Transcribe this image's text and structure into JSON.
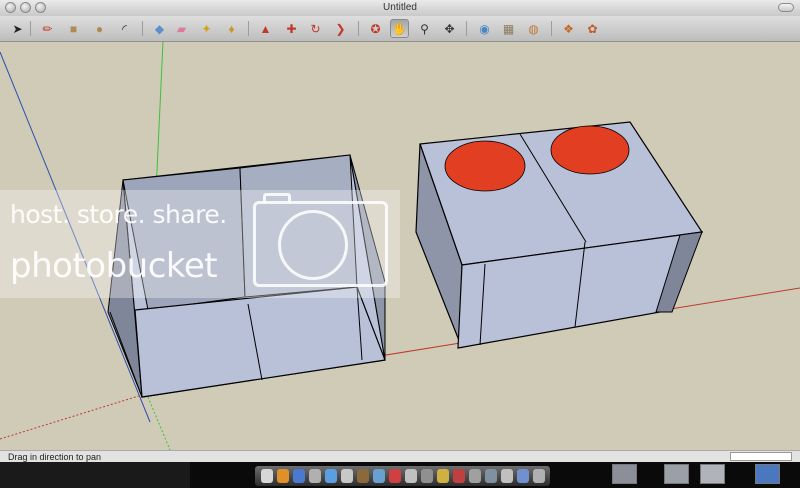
{
  "window": {
    "title": "Untitled"
  },
  "toolbar": {
    "tools": [
      {
        "icon": "select-arrow-icon",
        "glyph": "➤",
        "color": "#222"
      },
      {
        "icon": "pencil-icon",
        "glyph": "✏",
        "color": "#c0392b"
      },
      {
        "icon": "rectangle-icon",
        "glyph": "■",
        "color": "#b08a55"
      },
      {
        "icon": "circle-icon",
        "glyph": "●",
        "color": "#b08a55"
      },
      {
        "icon": "arc-icon",
        "glyph": "◜",
        "color": "#222"
      },
      {
        "icon": "make-component-icon",
        "glyph": "◆",
        "color": "#5e8fc9"
      },
      {
        "icon": "eraser-icon",
        "glyph": "▰",
        "color": "#e07a9a"
      },
      {
        "icon": "tape-measure-icon",
        "glyph": "✦",
        "color": "#d4a017"
      },
      {
        "icon": "paint-bucket-icon",
        "glyph": "♦",
        "color": "#c89a2c"
      },
      {
        "icon": "push-pull-icon",
        "glyph": "▲",
        "color": "#c0392b"
      },
      {
        "icon": "move-icon",
        "glyph": "✚",
        "color": "#c0392b"
      },
      {
        "icon": "rotate-icon",
        "glyph": "↻",
        "color": "#c0392b"
      },
      {
        "icon": "offset-icon",
        "glyph": "❯",
        "color": "#c0392b"
      },
      {
        "icon": "orbit-icon",
        "glyph": "✪",
        "color": "#c0392b"
      },
      {
        "icon": "pan-hand-icon",
        "glyph": "✋",
        "color": "#333"
      },
      {
        "icon": "zoom-icon",
        "glyph": "⚲",
        "color": "#333"
      },
      {
        "icon": "zoom-extents-icon",
        "glyph": "✥",
        "color": "#333"
      },
      {
        "icon": "get-models-icon",
        "glyph": "◉",
        "color": "#4a86c5"
      },
      {
        "icon": "share-model-icon",
        "glyph": "▦",
        "color": "#8a7a5a"
      },
      {
        "icon": "google-earth-icon",
        "glyph": "◍",
        "color": "#c07a3a"
      },
      {
        "icon": "component-store-icon",
        "glyph": "❖",
        "color": "#c06a2a"
      },
      {
        "icon": "photo-textures-icon",
        "glyph": "✿",
        "color": "#c05a2a"
      }
    ],
    "active_tool": "pan-hand-icon"
  },
  "status": {
    "hint": "Drag in direction to pan"
  },
  "watermark": {
    "line1": "host. store. share.",
    "line2": "photobucket"
  },
  "colors": {
    "face": "#b9c1d8",
    "face_dark": "#8e95a8",
    "circle": "#e23e22",
    "background": "#cfcbb7",
    "axis_red": "#c0392b",
    "axis_green": "#3fbf3f",
    "axis_blue": "#2e4fb0"
  }
}
